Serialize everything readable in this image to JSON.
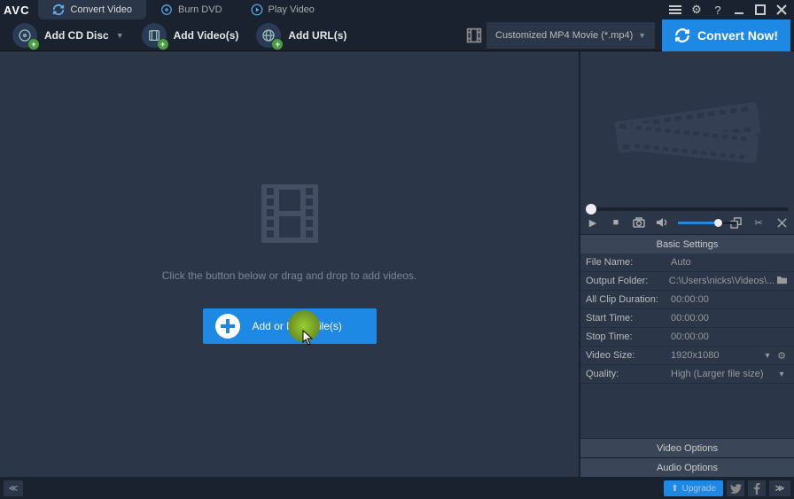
{
  "app": {
    "logo": "AVC"
  },
  "tabs": {
    "convert": "Convert Video",
    "burn": "Burn DVD",
    "play": "Play Video"
  },
  "toolbar": {
    "add_cd": "Add CD Disc",
    "add_videos": "Add Video(s)",
    "add_urls": "Add URL(s)",
    "format_selected": "Customized MP4 Movie (*.mp4)",
    "convert": "Convert Now!"
  },
  "drop": {
    "hint": "Click the button below or drag and drop to add videos.",
    "button": "Add or Drag File(s)"
  },
  "settings": {
    "header": "Basic Settings",
    "rows": [
      {
        "label": "File Name:",
        "value": "Auto"
      },
      {
        "label": "Output Folder:",
        "value": "C:\\Users\\nicks\\Videos\\..."
      },
      {
        "label": "All Clip Duration:",
        "value": "00:00:00"
      },
      {
        "label": "Start Time:",
        "value": "00:00:00"
      },
      {
        "label": "Stop Time:",
        "value": "00:00:00"
      },
      {
        "label": "Video Size:",
        "value": "1920x1080"
      },
      {
        "label": "Quality:",
        "value": "High (Larger file size)"
      }
    ],
    "video_options": "Video Options",
    "audio_options": "Audio Options"
  },
  "bottom": {
    "upgrade": "Upgrade"
  }
}
